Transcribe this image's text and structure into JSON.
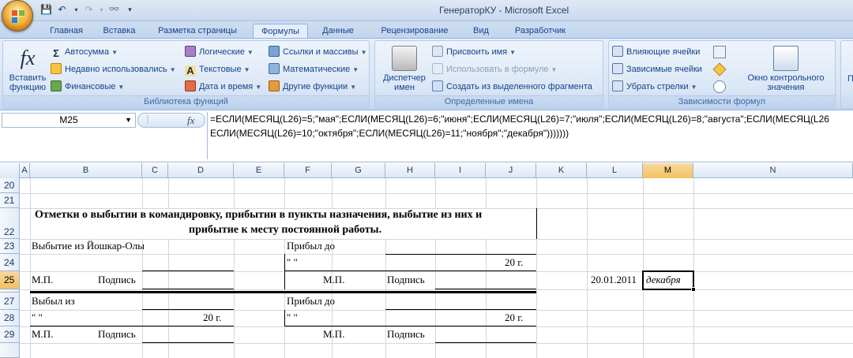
{
  "titlebar": {
    "title": "ГенераторКУ - Microsoft Excel"
  },
  "tabs": [
    "Главная",
    "Вставка",
    "Разметка страницы",
    "Формулы",
    "Данные",
    "Рецензирование",
    "Вид",
    "Разработчик"
  ],
  "active_tab": "Формулы",
  "ribbon": {
    "insert_function": {
      "line1": "Вставить",
      "line2": "функцию"
    },
    "library": {
      "autosum": "Автосумма",
      "recent": "Недавно использовались",
      "financial": "Финансовые",
      "logical": "Логические",
      "text": "Текстовые",
      "datetime": "Дата и время",
      "lookup": "Ссылки и массивы",
      "math": "Математические",
      "other": "Другие функции",
      "group_label": "Библиотека функций"
    },
    "names": {
      "manager_line1": "Диспетчер",
      "manager_line2": "имен",
      "define": "Присвоить имя",
      "use": "Использовать в формуле",
      "create": "Создать из выделенного фрагмента",
      "group_label": "Определенные имена"
    },
    "audit": {
      "precedents": "Влияющие ячейки",
      "dependents": "Зависимые ячейки",
      "remove_arrows": "Убрать стрелки",
      "watch_line1": "Окно контрольного",
      "watch_line2": "значения",
      "group_label": "Зависимости формул",
      "partial_label": "П"
    }
  },
  "formula_bar": {
    "name_box": "M25",
    "fx": "fx",
    "formula_line1": "=ЕСЛИ(МЕСЯЦ(L26)=5;\"мая\";ЕСЛИ(МЕСЯЦ(L26)=6;\"июня\";ЕСЛИ(МЕСЯЦ(L26)=7;\"июля\";ЕСЛИ(МЕСЯЦ(L26)=8;\"августа\";ЕСЛИ(МЕСЯЦ(L26",
    "formula_line2": "ЕСЛИ(МЕСЯЦ(L26)=10;\"октября\";ЕСЛИ(МЕСЯЦ(L26)=11;\"ноября\";\"декабря\")))))))"
  },
  "columns": [
    "A",
    "B",
    "C",
    "D",
    "E",
    "F",
    "G",
    "H",
    "I",
    "J",
    "K",
    "L",
    "M",
    "N"
  ],
  "selected_column": "M",
  "rows": [
    "20",
    "21",
    "22",
    "23",
    "24",
    "25",
    "27",
    "28",
    "29"
  ],
  "selected_row": "25",
  "cells": {
    "title_line1": "Отметки о выбытии в командировку, прибытии в пункты назначения, выбытие из них и",
    "title_line2": "прибытие к месту постоянной работы.",
    "r23_b": "Выбытие из Йошкар-Олы",
    "r23_f": "Прибыл до",
    "r24_f": "\"          \"",
    "r24_j": "20    г.",
    "r25_mp": "М.П.",
    "r25_sign": "Подпись",
    "r25_mp2": "М.П.",
    "r25_sign2": "Подпись",
    "r25_l": "20.01.2011",
    "r25_m": "декабря",
    "r27_b": "Выбыл из",
    "r27_f": "Прибыл до",
    "r28_b": "\"          \"",
    "r28_d": "20    г.",
    "r28_f": "\"          \"",
    "r28_j": "20    г.",
    "r29_mp": "М.П.",
    "r29_sign": "Подпись",
    "r29_mp2": "М.П.",
    "r29_sign2": "Подпись"
  }
}
